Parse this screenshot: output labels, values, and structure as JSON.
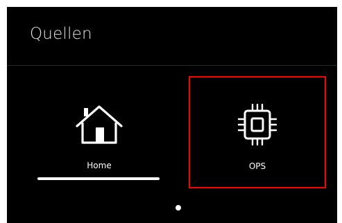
{
  "header": {
    "title": "Quellen"
  },
  "sources": [
    {
      "label": "Home",
      "icon": "home-icon",
      "active": true
    },
    {
      "label": "OPS",
      "icon": "chip-icon",
      "selected": true
    }
  ],
  "pagination": {
    "current_page": 1,
    "page_count": 1
  },
  "colors": {
    "background": "#000000",
    "text": "#ffffff",
    "selection_border": "#ff0000"
  }
}
